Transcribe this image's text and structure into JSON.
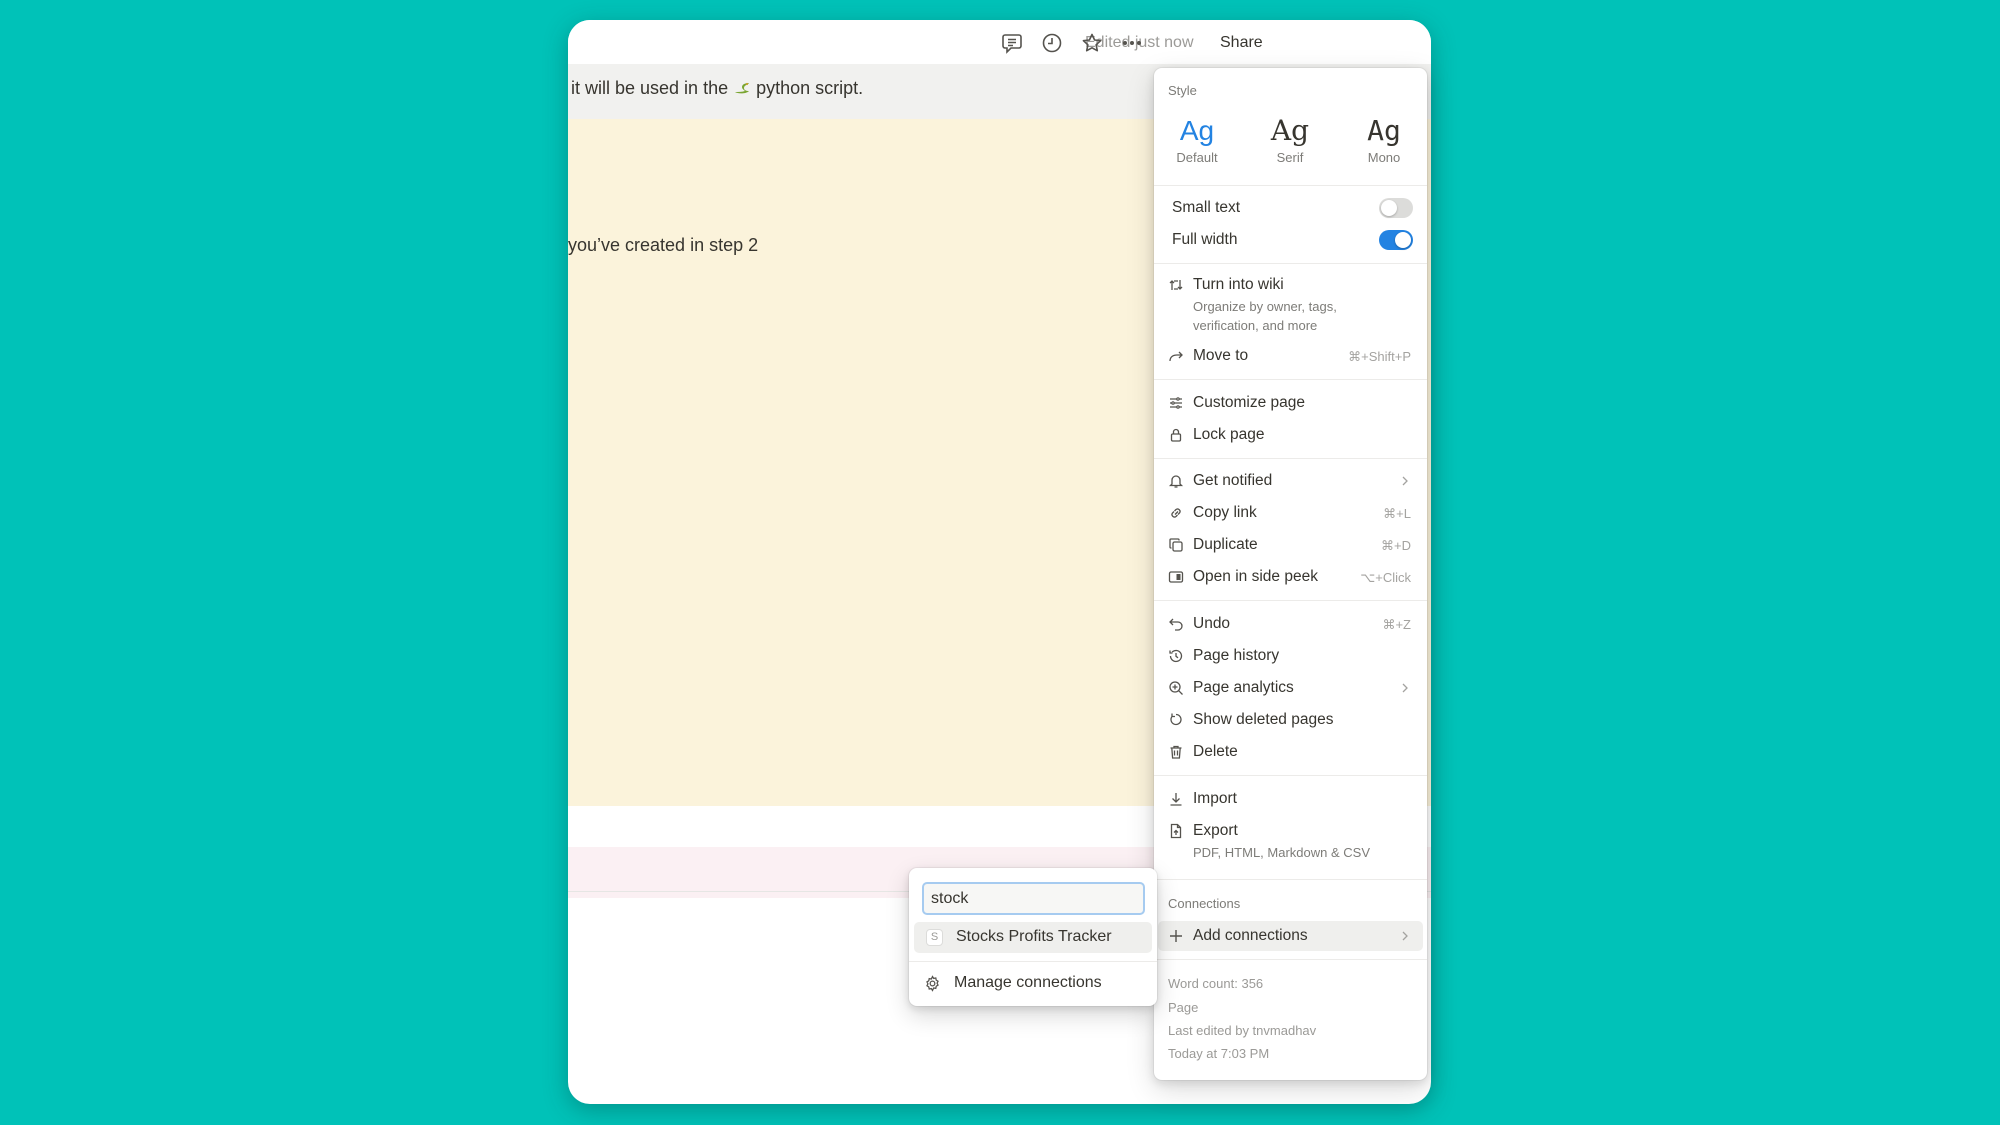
{
  "header": {
    "edited_status": "Edited just now",
    "share_label": "Share",
    "icons": [
      "comment-icon",
      "clock-icon",
      "star-icon",
      "more-icon"
    ]
  },
  "page_content": {
    "gray_block_text_before": "it will be used in the ",
    "gray_block_emoji": "snake-emoji",
    "gray_block_text_after": " python script.",
    "yellow_block_text": "you’ve created in step 2"
  },
  "menu": {
    "style_label": "Style",
    "fonts": [
      {
        "glyph": "Ag",
        "label": "Default",
        "selected": true
      },
      {
        "glyph": "Ag",
        "label": "Serif",
        "selected": false
      },
      {
        "glyph": "Ag",
        "label": "Mono",
        "selected": false
      }
    ],
    "toggles": [
      {
        "label": "Small text",
        "on": false
      },
      {
        "label": "Full width",
        "on": true
      }
    ],
    "turn_into_wiki": {
      "label": "Turn into wiki",
      "subtitle_line1": "Organize by owner, tags,",
      "subtitle_line2": "verification, and more"
    },
    "move_to": {
      "label": "Move to",
      "shortcut": "⌘+Shift+P"
    },
    "customize_page": {
      "label": "Customize page"
    },
    "lock_page": {
      "label": "Lock page"
    },
    "get_notified": {
      "label": "Get notified"
    },
    "copy_link": {
      "label": "Copy link",
      "shortcut": "⌘+L"
    },
    "duplicate": {
      "label": "Duplicate",
      "shortcut": "⌘+D"
    },
    "open_side_peek": {
      "label": "Open in side peek",
      "shortcut": "⌥+Click"
    },
    "undo": {
      "label": "Undo",
      "shortcut": "⌘+Z"
    },
    "page_history": {
      "label": "Page history"
    },
    "page_analytics": {
      "label": "Page analytics"
    },
    "show_deleted": {
      "label": "Show deleted pages"
    },
    "delete": {
      "label": "Delete"
    },
    "import": {
      "label": "Import"
    },
    "export": {
      "label": "Export",
      "subtitle": "PDF, HTML, Markdown & CSV"
    },
    "connections_label": "Connections",
    "add_connections": {
      "label": "Add connections"
    },
    "footer": {
      "word_count": "Word count: 356",
      "type": "Page",
      "last_edited_by": "Last edited by tnvmadhav",
      "last_edited_time": "Today at 7:03 PM"
    }
  },
  "connections_popup": {
    "search_value": "stock",
    "results": [
      {
        "badge": "S",
        "label": "Stocks Profits Tracker"
      }
    ],
    "manage_label": "Manage connections"
  },
  "colors": {
    "accent": "#2383e2",
    "background": "#00c2b8",
    "yellow_block": "#fbf3db",
    "pink_block": "#fbf0f3",
    "gray_block": "#f1f1ef"
  }
}
